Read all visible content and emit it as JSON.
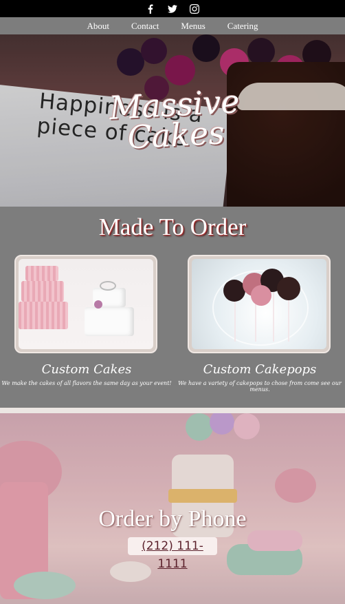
{
  "social": [
    {
      "name": "facebook"
    },
    {
      "name": "twitter"
    },
    {
      "name": "instagram"
    }
  ],
  "nav": [
    "About",
    "Contact",
    "Menus",
    "Catering"
  ],
  "hero": {
    "plate_text_line1": "Happiness is a",
    "plate_text_line2": "piece of cake",
    "logo_line1": "Massive",
    "logo_line2": "Cakes"
  },
  "made_to_order": {
    "heading": "Made To Order",
    "cards": [
      {
        "title": "Custom Cakes",
        "desc": "We make the cakes of all flavors the same day as your event!"
      },
      {
        "title": "Custom Cakepops",
        "desc": "We have a variety of cakepops to chose from come see our menus."
      }
    ]
  },
  "order": {
    "heading": "Order by Phone",
    "phone": "(212) 111-1111"
  }
}
